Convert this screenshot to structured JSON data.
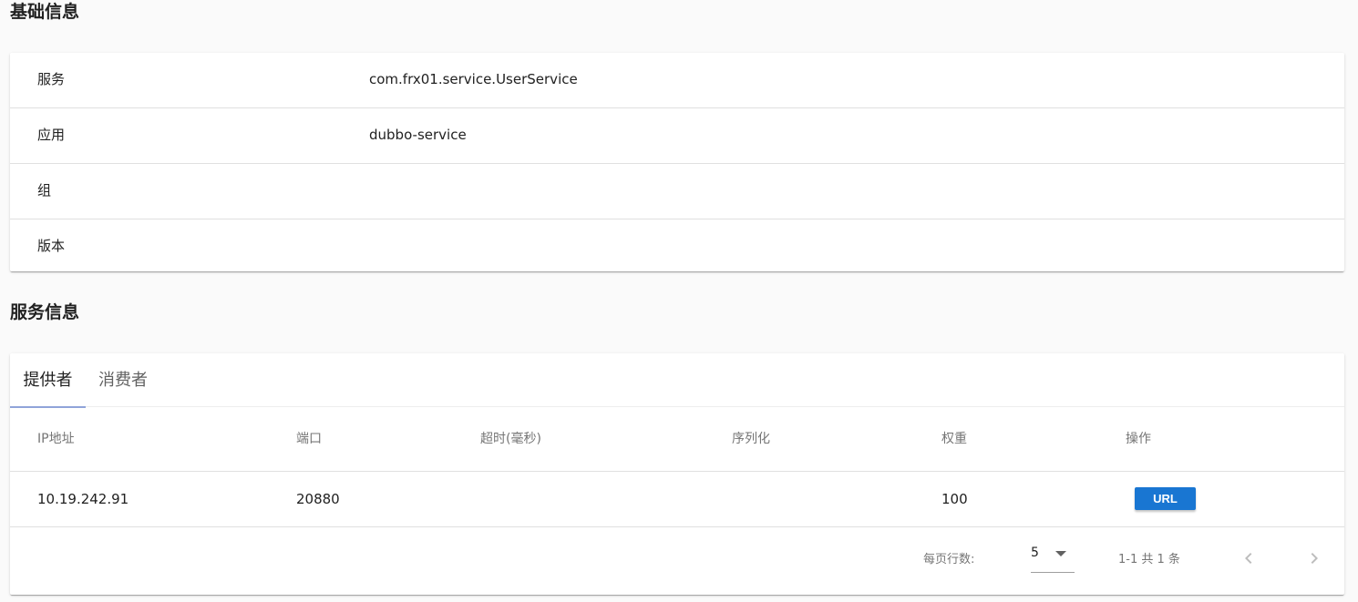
{
  "basic_section": {
    "title": "基础信息",
    "rows": [
      {
        "key": "服务",
        "value": "com.frx01.service.UserService"
      },
      {
        "key": "应用",
        "value": "dubbo-service"
      },
      {
        "key": "组",
        "value": ""
      },
      {
        "key": "版本",
        "value": ""
      }
    ]
  },
  "service_section": {
    "title": "服务信息",
    "tabs": [
      {
        "label": "提供者",
        "active": true
      },
      {
        "label": "消费者",
        "active": false
      }
    ],
    "table": {
      "headers": [
        "IP地址",
        "端口",
        "超时(毫秒)",
        "序列化",
        "权重",
        "操作"
      ],
      "rows": [
        {
          "ip": "10.19.242.91",
          "port": "20880",
          "timeout": "",
          "serialization": "",
          "weight": "100",
          "action_label": "URL"
        }
      ]
    },
    "pagination": {
      "rows_per_page_label": "每页行数:",
      "rows_per_page_value": "5",
      "page_info": "1-1 共 1 条"
    }
  },
  "colors": {
    "accent": "#1976d2",
    "tab_indicator": "#90a4d9",
    "background": "#fafafa"
  },
  "icons": {
    "rows_per_page_dropdown": "caret-down-icon",
    "prev": "chevron-left-icon",
    "next": "chevron-right-icon"
  }
}
